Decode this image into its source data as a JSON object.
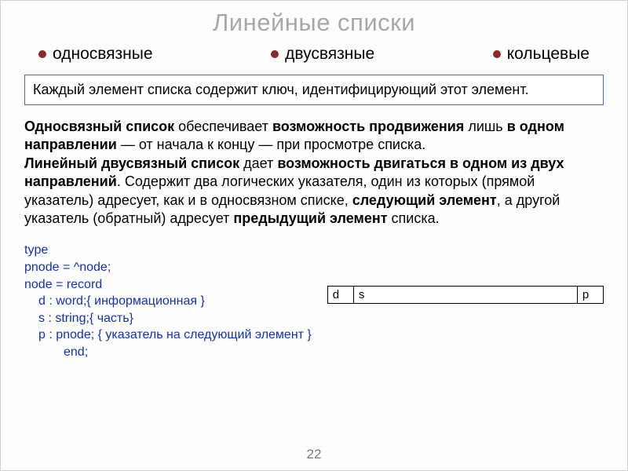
{
  "title": "Линейные списки",
  "bullets": {
    "b1": "односвязные",
    "b2": "двусвязные",
    "b3": "кольцевые"
  },
  "key_box": "Каждый элемент списка содержит ключ, идентифицирующий этот элемент.",
  "desc": {
    "p1a": "Односвязный список",
    "p1b": " обеспечивает ",
    "p1c": "возможность продвижения",
    "p1d": " лишь ",
    "p1e": "в одном направлении",
    "p1f": " — от начала к концу — при просмотре списка.",
    "p2a": "Линейный двусвязный список",
    "p2b": " дает ",
    "p2c": "возможность двигаться в одном из двух направлений",
    "p2d": ". Содержит два логических указателя, один из которых (прямой указатель) адресует, как и в односвязном списке, ",
    "p2e": "следующий элемент",
    "p2f": ", а другой указатель (обратный) адресует ",
    "p2g": "предыдущий элемент",
    "p2h": " списка."
  },
  "code": {
    "l1": "type",
    "l2": "pnode =  ^node;",
    "l3": "node = record",
    "l4": "d : word;{ информационная }",
    "l5": "s : string;{ часть}",
    "l6": "p : pnode; { указатель на следующий элемент }",
    "l7": "end;"
  },
  "table": {
    "d": "d",
    "s": "s",
    "p": "p"
  },
  "page": "22"
}
